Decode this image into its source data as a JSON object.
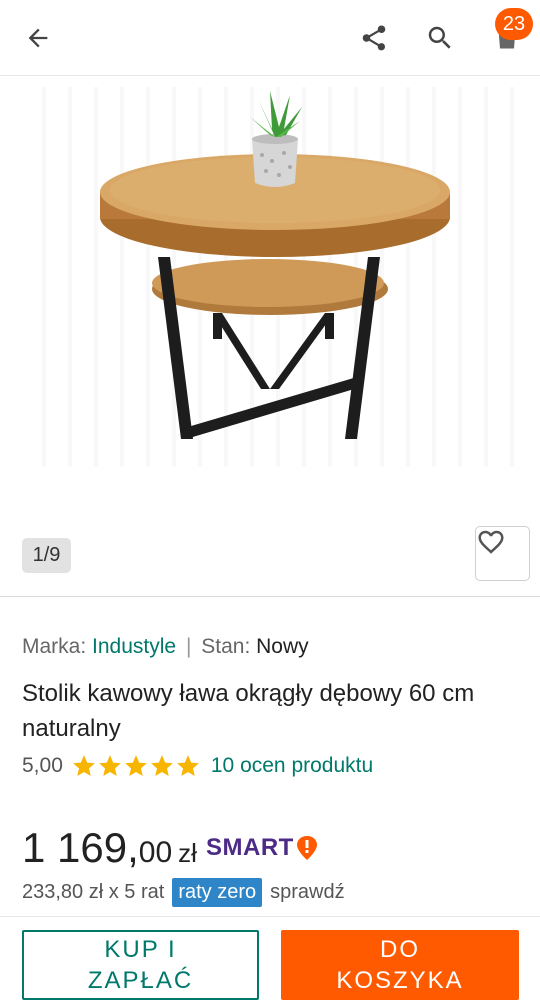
{
  "header": {
    "back_icon": "arrow-left-icon",
    "share_icon": "share-icon",
    "search_icon": "search-icon",
    "cart_icon": "cart-icon",
    "cart_count": "23"
  },
  "gallery": {
    "counter": "1/9",
    "favorite_icon": "heart-icon"
  },
  "product": {
    "brand_label": "Marka:",
    "brand_value": "Industyle",
    "separator": "|",
    "condition_label": "Stan:",
    "condition_value": "Nowy",
    "title": "Stolik kawowy ława okrągły dębowy 60 cm naturalny",
    "rating_value": "5,00",
    "star_count": 5,
    "reviews_link": "10 ocen produktu",
    "price_integer": "1 169,",
    "price_decimal": "00",
    "price_currency": "zł",
    "smart_label": "SMART",
    "installment_text": "233,80 zł x 5 rat",
    "raty_badge": "raty zero",
    "check_link": "sprawdź"
  },
  "actions": {
    "buy_now_line1": "KUP I",
    "buy_now_line2": "ZAPŁAĆ",
    "add_to_cart_line1": "DO",
    "add_to_cart_line2": "KOSZYKA"
  },
  "colors": {
    "accent_orange": "#ff5a00",
    "accent_teal": "#00796b",
    "smart_purple": "#4c2a86",
    "star_yellow": "#f7b500",
    "raty_blue": "#2e86c9"
  }
}
